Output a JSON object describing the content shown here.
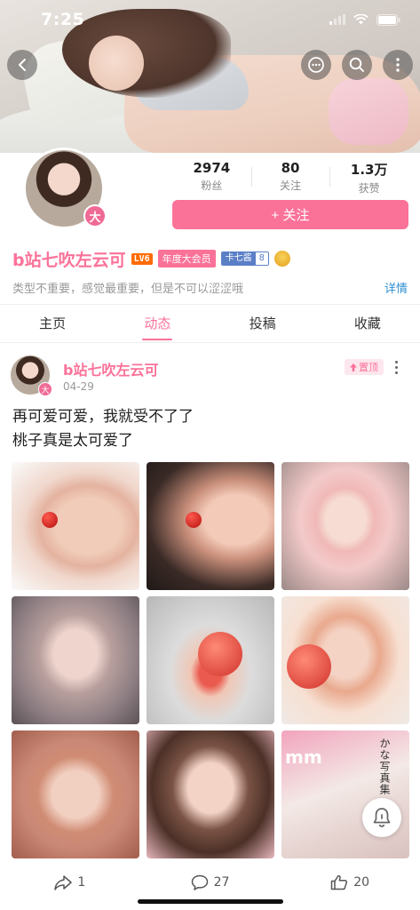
{
  "status_bar": {
    "time": "7:25"
  },
  "profile": {
    "avatar_badge": "大",
    "stats": [
      {
        "value": "2974",
        "label": "粉丝"
      },
      {
        "value": "80",
        "label": "关注"
      },
      {
        "value": "1.3万",
        "label": "获赞"
      }
    ],
    "follow_label": "+ 关注",
    "username": "b站七吹左云可",
    "level_badge": "LV6",
    "vip_badge": "年度大会员",
    "medal": {
      "name": "卡七酱",
      "level": "8"
    },
    "signature": "类型不重要，感觉最重要，但是不可以涩涩哦",
    "detail_link": "详情"
  },
  "tabs": [
    {
      "label": "主页",
      "active": false
    },
    {
      "label": "动态",
      "active": true
    },
    {
      "label": "投稿",
      "active": false
    },
    {
      "label": "收藏",
      "active": false
    }
  ],
  "post": {
    "author": "b站七吹左云可",
    "date": "04-29",
    "avatar_badge": "大",
    "pin_label": "置顶",
    "text_lines": [
      "再可爱可爱，我就受不了了",
      "桃子真是太可爱了"
    ],
    "image_count": 9,
    "image_9_text": "かな写真集",
    "image_9_logo": "mm",
    "actions": {
      "share_count": "1",
      "comment_count": "27",
      "like_count": "20"
    }
  },
  "colors": {
    "accent_pink": "#fb7299",
    "link_blue": "#2f8fd1",
    "level_orange": "#ff6c00",
    "medal_blue": "#5b7fc7"
  }
}
